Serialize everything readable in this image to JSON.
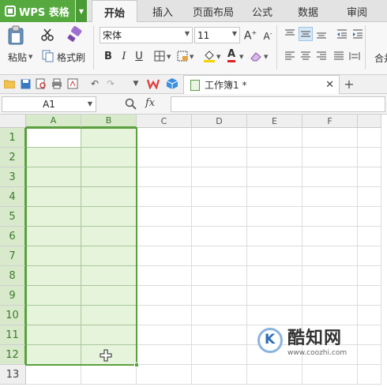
{
  "app": {
    "name": "WPS 表格"
  },
  "tabs": [
    {
      "label": "开始",
      "active": true
    },
    {
      "label": "插入",
      "active": false
    },
    {
      "label": "页面布局",
      "active": false
    },
    {
      "label": "公式",
      "active": false
    },
    {
      "label": "数据",
      "active": false
    },
    {
      "label": "审阅",
      "active": false
    }
  ],
  "ribbon": {
    "paste_label": "粘贴",
    "format_painter_label": "格式刷",
    "font_name": "宋体",
    "font_size": "11",
    "merge_label": "合并"
  },
  "document": {
    "tab_title": "工作簿1 *"
  },
  "formula_bar": {
    "name_box": "A1",
    "fx_label": "fx",
    "formula": ""
  },
  "grid": {
    "columns": [
      "A",
      "B",
      "C",
      "D",
      "E",
      "F"
    ],
    "rows": [
      "1",
      "2",
      "3",
      "4",
      "5",
      "6",
      "7",
      "8",
      "9",
      "10",
      "11",
      "12",
      "13"
    ],
    "selected_columns": [
      "A",
      "B"
    ],
    "selected_rows_count": 12
  },
  "watermark": {
    "title": "酷知网",
    "url": "www.coozhi.com"
  },
  "colors": {
    "accent": "#55a93f",
    "selection_fill": "#e6f4dc",
    "selection_border": "#5aa03f"
  }
}
